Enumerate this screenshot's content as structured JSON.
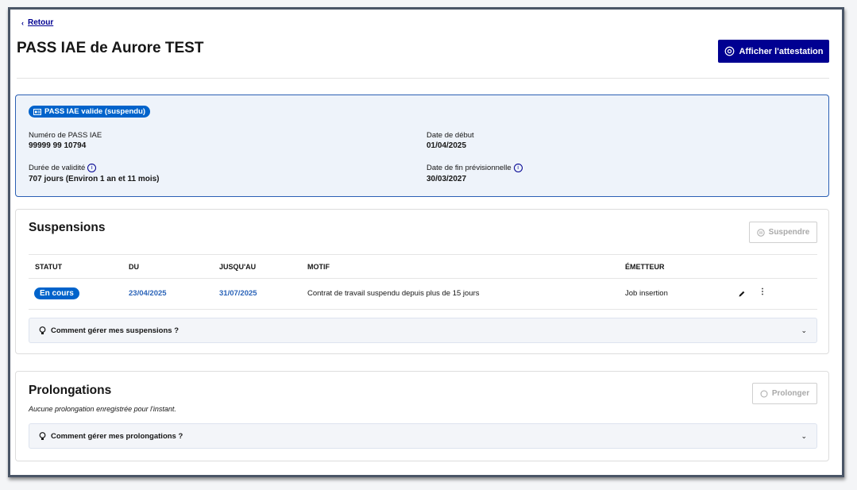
{
  "header": {
    "back_label": "Retour",
    "title": "PASS IAE de Aurore TEST",
    "attestation_button": "Afficher l'attestation"
  },
  "pass": {
    "badge": "PASS IAE valide (suspendu)",
    "number_label": "Numéro de PASS IAE",
    "number_value": "99999 99 10794",
    "start_label": "Date de début",
    "start_value": "01/04/2025",
    "validity_label": "Durée de validité",
    "validity_value": "707 jours (Environ 1 an et 11 mois)",
    "end_label": "Date de fin prévisionnelle",
    "end_value": "30/03/2027"
  },
  "suspensions": {
    "title": "Suspensions",
    "button": "Suspendre",
    "columns": [
      "STATUT",
      "DU",
      "JUSQU'AU",
      "MOTIF",
      "ÉMETTEUR"
    ],
    "rows": [
      {
        "status": "En cours",
        "from": "23/04/2025",
        "to": "31/07/2025",
        "reason": "Contrat de travail suspendu depuis plus de 15 jours",
        "issuer": "Job insertion"
      }
    ],
    "help": "Comment gérer mes suspensions ?"
  },
  "prolongations": {
    "title": "Prolongations",
    "button": "Prolonger",
    "empty_note": "Aucune prolongation enregistrée pour l'instant.",
    "help": "Comment gérer mes prolongations ?"
  },
  "colors": {
    "primary": "#000091",
    "badge_blue": "#0063cb",
    "card_bg": "#eef3fa"
  }
}
